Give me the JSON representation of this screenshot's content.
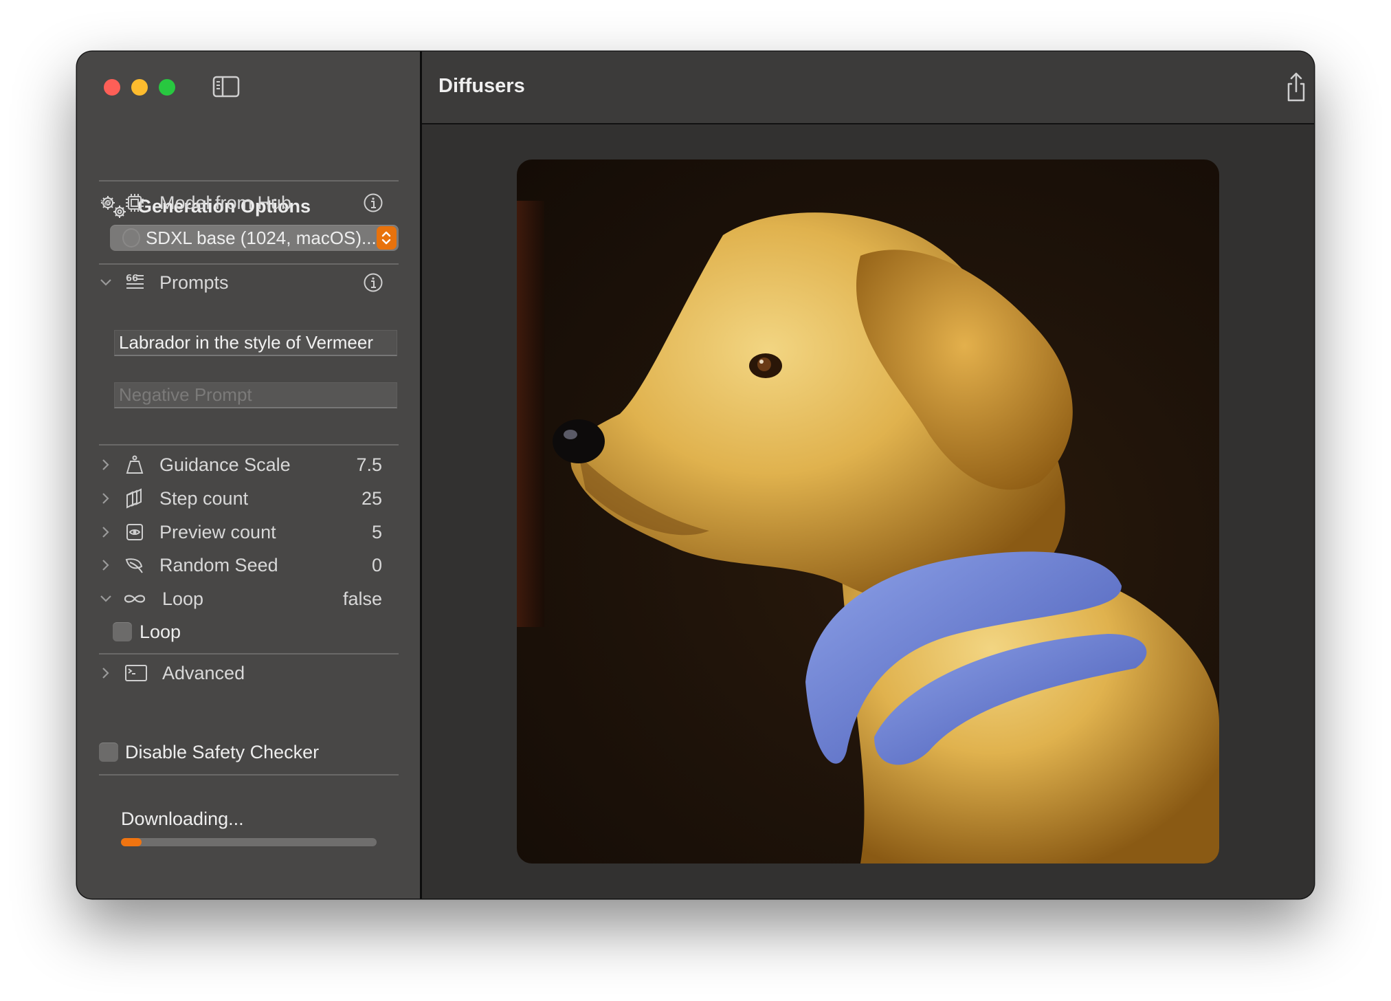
{
  "window": {
    "title": "Diffusers",
    "traffic_lights": [
      "close",
      "minimize",
      "zoom"
    ]
  },
  "toolbar": {
    "share_icon": "square-and-arrow-up-icon",
    "save_icon": "square-and-arrow-down-icon"
  },
  "sidebar": {
    "header": "Generation Options",
    "model": {
      "label": "Model from Hub",
      "selected": "SDXL base (1024, macOS)...",
      "expanded": true
    },
    "prompts": {
      "label": "Prompts",
      "prompt_value": "Labrador in the style of Vermeer",
      "negative_placeholder": "Negative Prompt",
      "negative_value": "",
      "expanded": true
    },
    "parameters": [
      {
        "label": "Guidance Scale",
        "value": "7.5",
        "icon": "scalemass-icon",
        "expanded": false
      },
      {
        "label": "Step count",
        "value": "25",
        "icon": "square-stack-icon",
        "expanded": false
      },
      {
        "label": "Preview count",
        "value": "5",
        "icon": "eye-square-icon",
        "expanded": false
      },
      {
        "label": "Random Seed",
        "value": "0",
        "icon": "leaf-icon",
        "expanded": false
      },
      {
        "label": "Loop",
        "value": "false",
        "icon": "infinity-icon",
        "expanded": true
      }
    ],
    "loop_checkbox": {
      "label": "Loop",
      "checked": false
    },
    "advanced": {
      "label": "Advanced",
      "expanded": false
    },
    "safety_checkbox": {
      "label": "Disable Safety Checker",
      "checked": false
    },
    "status": {
      "text": "Downloading...",
      "progress": 0.08
    }
  },
  "canvas": {
    "image_description": "Generated painting of a yellow Labrador in profile wearing a blue scarf, in the style of Vermeer"
  },
  "colors": {
    "accent": "#e8720c",
    "sidebar_bg": "#484746",
    "main_bg": "#323130",
    "toolbar_bg": "#3c3b3a",
    "close": "#fe5f57",
    "minimize": "#febc2e",
    "zoom": "#28c840"
  }
}
